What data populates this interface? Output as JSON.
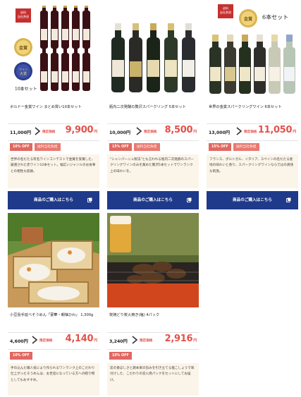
{
  "products": [
    {
      "name": "ボルドー金賞ワイン まとめ買い10本セット",
      "original_price": "11,000円",
      "special_label": "限定価格",
      "special_price": "9,900",
      "yen": "円",
      "discount": "10% OFF",
      "shipping": "送料当社負担",
      "description": "世界の名だたる有名ワインコンテストで金賞を受賞した、厳選された赤ワイン10本セット。幅広いジャンルのお食事との相性も抜群。",
      "cta": "商品のご購入はこちら",
      "stamp": "送料\n当社負担",
      "medal": "金賞",
      "set_label": "10本セット"
    },
    {
      "name": "瓶内二次発酵の贅沢スパークリング 5本セット",
      "original_price": "10,000円",
      "special_label": "限定価格",
      "special_price": "8,500",
      "yen": "円",
      "discount": "15% OFF",
      "shipping": "送料当社負担",
      "description": "\"シャンパーニュ製法\"とも言われる瓶内二次発酵のスパークリングワインのみを集めた贅沢5本セットでワンランク上の味わいを。",
      "cta": "商品のご購入はこちら"
    },
    {
      "name": "世界の金賞スパークリングワイン 6本セット",
      "original_price": "13,000円",
      "special_label": "限定価格",
      "special_price": "11,050",
      "yen": "円",
      "discount": "15% OFF",
      "shipping": "送料当社負担",
      "description": "フランス、ポルトガル、イタリア、スペインの名だたる産地の味わいと香り、スパークリングワインならではの爽快な刺激。",
      "cta": "商品のご購入はこちら",
      "stamp": "送料\n当社負担",
      "medal": "金賞",
      "set_label": "6本セット"
    },
    {
      "name": "小豆島手延べそうめん「宴華・朝柚ひわ」 1,300g",
      "original_price": "4,600円",
      "special_label": "限定価格",
      "special_price": "4,140",
      "yen": "円",
      "discount": "10% OFF",
      "description": "手の込んだ職人技により作られるワンランク上のこだわり仕上がったそうめんは、お世話になっている方への贈り物としてもおすすめ。"
    },
    {
      "name": "炭焼どり炭火焼き(塩) 4パック",
      "original_price": "3,240円",
      "special_label": "限定価格",
      "special_price": "2,916",
      "yen": "円",
      "discount": "10% OFF",
      "description": "炭の香ばしさと鶏本来の旨みを引き立てる塩こしょうで味付けした、こだわりの炭火焼パックをセットにしてお届け。"
    }
  ],
  "colors": {
    "accent": "#e2524a",
    "cta": "#1f3a8a",
    "desc_bg": "#fbf4e8",
    "badge": "#e06860"
  },
  "icons": {
    "chevron": "chevron-right-icon",
    "external": "external-link-icon"
  }
}
